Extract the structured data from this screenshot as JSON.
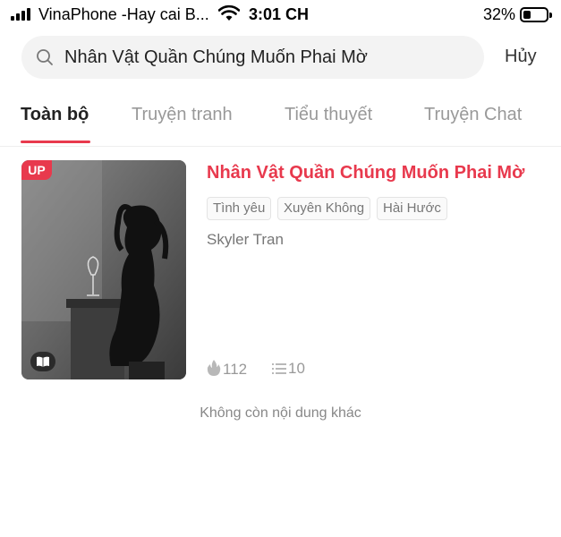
{
  "status_bar": {
    "carrier": "VinaPhone -Hay cai B...",
    "time": "3:01 CH",
    "battery_pct": "32%",
    "battery_level": 0.32
  },
  "search": {
    "query": "Nhân Vật Quần Chúng Muốn Phai Mờ",
    "cancel_label": "Hủy"
  },
  "tabs": [
    {
      "label": "Toàn bộ",
      "active": true
    },
    {
      "label": "Truyện tranh",
      "active": false
    },
    {
      "label": "Tiểu thuyết",
      "active": false
    },
    {
      "label": "Truyện Chat",
      "active": false
    }
  ],
  "result": {
    "badge": "UP",
    "title": "Nhân Vật Quần Chúng Muốn Phai Mờ",
    "tags": [
      "Tình yêu",
      "Xuyên Không",
      "Hài Hước"
    ],
    "author": "Skyler Tran",
    "likes": "112",
    "chapters": "10"
  },
  "footer": {
    "end_text": "Không còn nội dung khác"
  },
  "colors": {
    "accent": "#e8394d",
    "muted_text": "#999999"
  }
}
